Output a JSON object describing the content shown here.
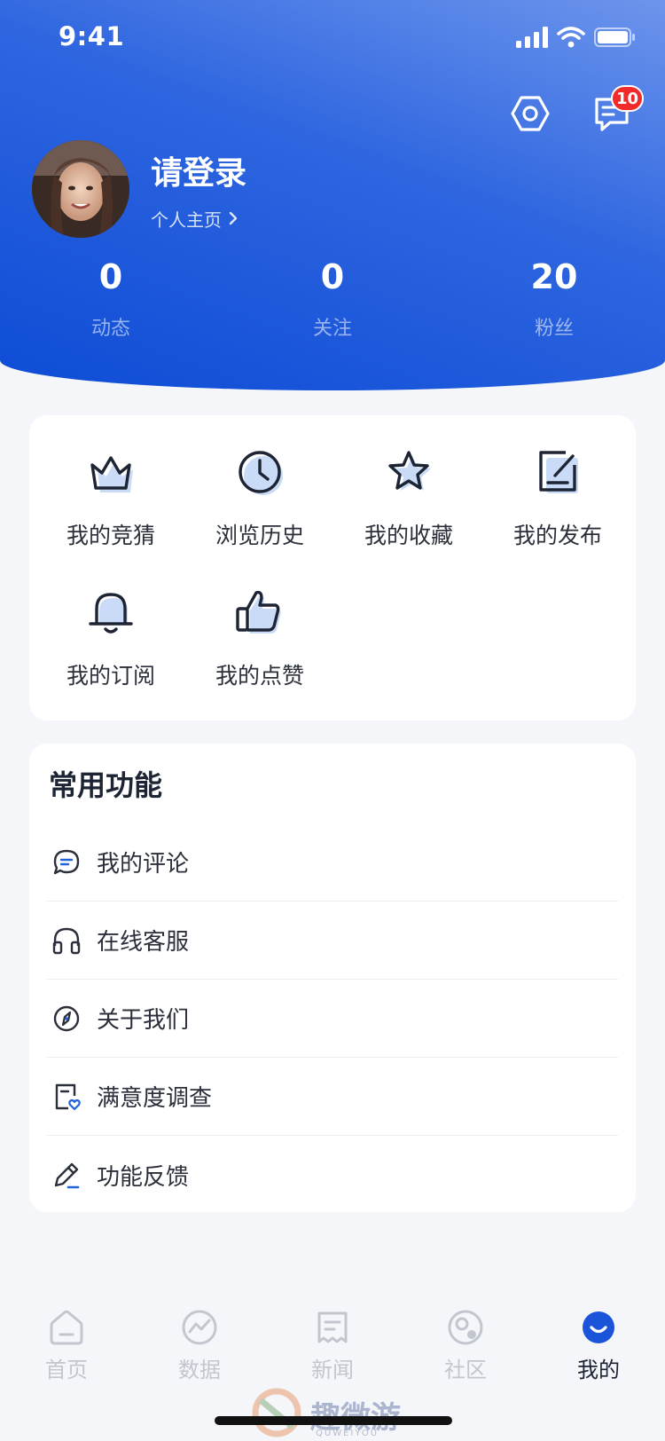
{
  "status_bar": {
    "time": "9:41"
  },
  "header": {
    "notification_count": "10",
    "profile": {
      "name": "请登录",
      "link_label": "个人主页"
    },
    "stats": [
      {
        "value": "0",
        "label": "动态"
      },
      {
        "value": "0",
        "label": "关注"
      },
      {
        "value": "20",
        "label": "粉丝"
      }
    ]
  },
  "quick_grid": {
    "items": [
      {
        "label": "我的竞猜",
        "icon": "crown-icon"
      },
      {
        "label": "浏览历史",
        "icon": "clock-icon"
      },
      {
        "label": "我的收藏",
        "icon": "star-icon"
      },
      {
        "label": "我的发布",
        "icon": "edit-document-icon"
      },
      {
        "label": "我的订阅",
        "icon": "bell-icon"
      },
      {
        "label": "我的点赞",
        "icon": "thumbs-up-icon"
      }
    ]
  },
  "common_functions": {
    "title": "常用功能",
    "items": [
      {
        "label": "我的评论",
        "icon": "comment-icon"
      },
      {
        "label": "在线客服",
        "icon": "headset-icon"
      },
      {
        "label": "关于我们",
        "icon": "compass-icon"
      },
      {
        "label": "满意度调查",
        "icon": "survey-heart-icon"
      },
      {
        "label": "功能反馈",
        "icon": "pencil-icon"
      }
    ]
  },
  "tabbar": {
    "tabs": [
      {
        "label": "首页",
        "icon": "home-icon",
        "active": false
      },
      {
        "label": "数据",
        "icon": "chart-icon",
        "active": false
      },
      {
        "label": "新闻",
        "icon": "news-icon",
        "active": false
      },
      {
        "label": "社区",
        "icon": "community-icon",
        "active": false
      },
      {
        "label": "我的",
        "icon": "profile-icon",
        "active": true
      }
    ]
  },
  "watermark": {
    "text": "趣微游",
    "subtext": "QUWEIYOU"
  },
  "colors": {
    "primary": "#1a55d9",
    "header_gradient_start": "#6d95ec",
    "header_gradient_end": "#0d4cd6",
    "badge": "#f12a2a",
    "icon_accent": "#c9dbf6",
    "page_background": "#f5f6fa"
  }
}
